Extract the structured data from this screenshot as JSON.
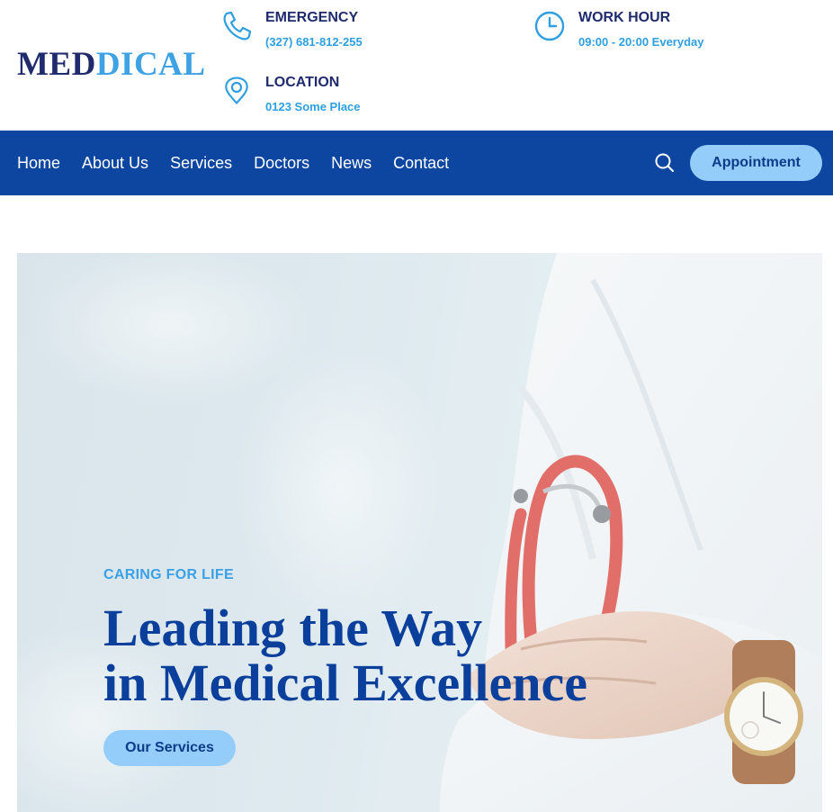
{
  "brand": {
    "part1": "MED",
    "part2": "DICAL"
  },
  "header": {
    "emergency": {
      "title": "EMERGENCY",
      "value": "(327) 681-812-255",
      "icon": "phone-icon"
    },
    "work_hour": {
      "title": "WORK HOUR",
      "value": "09:00 - 20:00 Everyday",
      "icon": "clock-icon"
    },
    "location": {
      "title": "LOCATION",
      "value": "0123 Some Place",
      "icon": "map-pin-icon"
    }
  },
  "nav": {
    "items": [
      "Home",
      "About Us",
      "Services",
      "Doctors",
      "News",
      "Contact"
    ],
    "search_icon": "search-icon",
    "appointment_label": "Appointment"
  },
  "hero": {
    "kicker": "CARING FOR LIFE",
    "headline_line1": "Leading the Way",
    "headline_line2": "in Medical Excellence",
    "cta_label": "Our Services"
  },
  "colors": {
    "primary": "#0c46a0",
    "navy": "#1f2b6c",
    "accent": "#3ea2e4",
    "button": "#94cdfa"
  }
}
